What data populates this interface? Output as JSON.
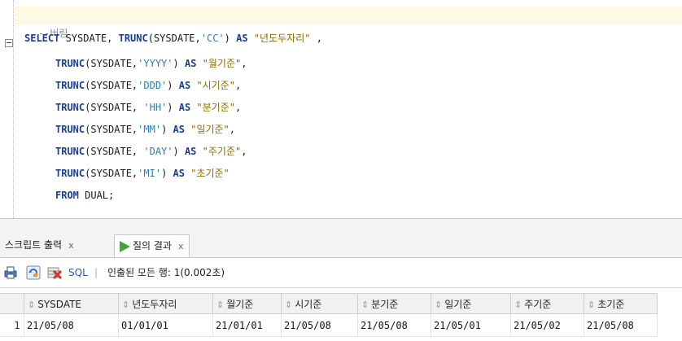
{
  "editor": {
    "comment": "--버림",
    "lines": [
      {
        "parts": [
          [
            "kw",
            "SELECT"
          ],
          [
            "plain",
            " SYSDATE, "
          ],
          [
            "fn",
            "TRUNC"
          ],
          [
            "plain",
            "(SYSDATE,"
          ],
          [
            "str",
            "'CC'"
          ],
          [
            "plain",
            ") "
          ],
          [
            "kw",
            "AS"
          ],
          [
            "plain",
            " "
          ],
          [
            "alias",
            "\"년도두자리\""
          ],
          [
            "plain",
            " ,"
          ]
        ]
      },
      {
        "parts": [
          [
            "fn",
            "TRUNC"
          ],
          [
            "plain",
            "(SYSDATE,"
          ],
          [
            "str",
            "'YYYY'"
          ],
          [
            "plain",
            ") "
          ],
          [
            "kw",
            "AS"
          ],
          [
            "plain",
            " "
          ],
          [
            "alias",
            "\"월기준\""
          ],
          [
            "plain",
            ","
          ]
        ]
      },
      {
        "parts": [
          [
            "fn",
            "TRUNC"
          ],
          [
            "plain",
            "(SYSDATE,"
          ],
          [
            "str",
            "'DDD'"
          ],
          [
            "plain",
            ") "
          ],
          [
            "kw",
            "AS"
          ],
          [
            "plain",
            " "
          ],
          [
            "alias",
            "\"시기준\""
          ],
          [
            "plain",
            ","
          ]
        ]
      },
      {
        "parts": [
          [
            "fn",
            "TRUNC"
          ],
          [
            "plain",
            "(SYSDATE, "
          ],
          [
            "str",
            "'HH'"
          ],
          [
            "plain",
            ") "
          ],
          [
            "kw",
            "AS"
          ],
          [
            "plain",
            " "
          ],
          [
            "alias",
            "\"분기준\""
          ],
          [
            "plain",
            ","
          ]
        ]
      },
      {
        "parts": [
          [
            "fn",
            "TRUNC"
          ],
          [
            "plain",
            "(SYSDATE,"
          ],
          [
            "str",
            "'MM'"
          ],
          [
            "plain",
            ") "
          ],
          [
            "kw",
            "AS"
          ],
          [
            "plain",
            " "
          ],
          [
            "alias",
            "\"일기준\""
          ],
          [
            "plain",
            ","
          ]
        ]
      },
      {
        "parts": [
          [
            "fn",
            "TRUNC"
          ],
          [
            "plain",
            "(SYSDATE, "
          ],
          [
            "str",
            "'DAY'"
          ],
          [
            "plain",
            ") "
          ],
          [
            "kw",
            "AS"
          ],
          [
            "plain",
            " "
          ],
          [
            "alias",
            "\"주기준\""
          ],
          [
            "plain",
            ","
          ]
        ]
      },
      {
        "parts": [
          [
            "fn",
            "TRUNC"
          ],
          [
            "plain",
            "(SYSDATE,"
          ],
          [
            "str",
            "'MI'"
          ],
          [
            "plain",
            ") "
          ],
          [
            "kw",
            "AS"
          ],
          [
            "plain",
            " "
          ],
          [
            "alias",
            "\"초기준\""
          ]
        ]
      },
      {
        "parts": [
          [
            "kw",
            "FROM"
          ],
          [
            "plain",
            " DUAL;"
          ]
        ]
      }
    ]
  },
  "tabs": {
    "script_output": "스크립트 출력",
    "query_result": "질의 결과",
    "close": "x"
  },
  "toolbar": {
    "sql_label": "SQL",
    "divider": "|",
    "status": "인출된 모든 행: 1(0.002초)"
  },
  "grid": {
    "columns": [
      "SYSDATE",
      "년도두자리",
      "월기준",
      "시기준",
      "분기준",
      "일기준",
      "주기준",
      "초기준"
    ],
    "rows": [
      {
        "num": "1",
        "cells": [
          "21/05/08",
          "01/01/01",
          "21/01/01",
          "21/05/08",
          "21/05/08",
          "21/05/01",
          "21/05/02",
          "21/05/08"
        ]
      }
    ]
  },
  "colors": {
    "keyword": "#1a3e91",
    "string": "#2a7fae",
    "alias": "#8a6d00",
    "comment": "#888888",
    "current_line": "#fdf9e3",
    "play_icon": "#3fa535"
  }
}
